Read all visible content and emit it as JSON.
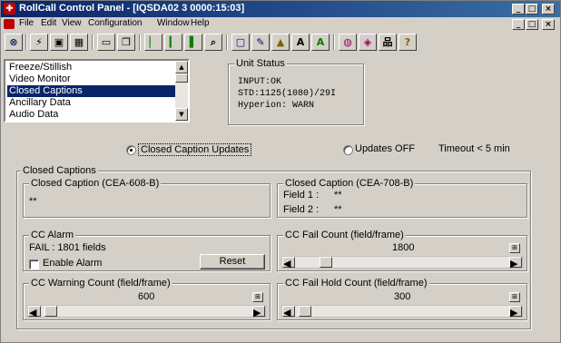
{
  "window": {
    "title": "RollCall Control Panel - [IQSDA02 3 0000:15:03]",
    "title_bg": "#0a246a"
  },
  "caption_buttons": {
    "minimize": "_",
    "maximize": "□",
    "close": "×"
  },
  "menu": {
    "items": [
      "File",
      "Edit",
      "View",
      "Configuration",
      "Window",
      "Help"
    ]
  },
  "toolbar": {
    "tools": [
      {
        "icon": "net-icon",
        "glyph": "⊗"
      },
      {
        "icon": "wand-icon",
        "glyph": "⚡"
      },
      {
        "icon": "image-icon",
        "glyph": "▣"
      },
      {
        "icon": "save-icon",
        "glyph": "▦"
      },
      {
        "icon": "monitor-icon",
        "glyph": "▭"
      },
      {
        "icon": "copy-icon",
        "glyph": "❐"
      },
      {
        "icon": "bar-low-icon",
        "glyph": "▏"
      },
      {
        "icon": "bar-mid-icon",
        "glyph": "▎"
      },
      {
        "icon": "bars-icon",
        "glyph": "▌"
      },
      {
        "icon": "zoom-icon",
        "glyph": "⌕"
      },
      {
        "icon": "screen-icon",
        "glyph": "▢"
      },
      {
        "icon": "edit-icon",
        "glyph": "✎"
      },
      {
        "icon": "lock-icon",
        "glyph": "▲"
      },
      {
        "icon": "font-a-icon",
        "glyph": "A"
      },
      {
        "icon": "font-a-green-icon",
        "glyph": "A"
      },
      {
        "icon": "globe-icon",
        "glyph": "◍"
      },
      {
        "icon": "shield-icon",
        "glyph": "◈"
      },
      {
        "icon": "network-icon",
        "glyph": "品"
      },
      {
        "icon": "help-icon",
        "glyph": "?"
      }
    ]
  },
  "list": {
    "items": [
      "Freeze/Stillish",
      "Video Monitor",
      "Closed Captions",
      "Ancillary Data",
      "Audio Data"
    ],
    "selected_index": 2
  },
  "unit_status": {
    "label": "Unit Status",
    "lines": [
      "INPUT:OK",
      "STD:1125(1080)/29I",
      "Hyperion: WARN"
    ]
  },
  "mode": {
    "updates_on_label": "Closed Caption Updates",
    "updates_off_label": "Updates OFF",
    "timeout_label": "Timeout < 5 min",
    "selected": "updates_on"
  },
  "captions": {
    "group_label": "Closed Captions",
    "cea608": {
      "label": "Closed Caption (CEA-608-B)",
      "value": "**"
    },
    "cea708": {
      "label": "Closed Caption (CEA-708-B)",
      "field1_label": "Field 1 :",
      "field1_value": "**",
      "field2_label": "Field 2 :",
      "field2_value": "**"
    }
  },
  "cc_alarm": {
    "label": "CC Alarm",
    "status": "FAIL : 1801 fields",
    "enable_label": "Enable Alarm",
    "enabled": false,
    "reset_label": "Reset"
  },
  "cc_fail_count": {
    "label": "CC Fail Count (field/frame)",
    "value": "1800",
    "position": 0.12
  },
  "cc_warning_count": {
    "label": "CC Warning Count (field/frame)",
    "value": "600",
    "position": 0.02
  },
  "cc_fail_hold_count": {
    "label": "CC Fail Hold Count (field/frame)",
    "value": "300",
    "position": 0.02
  },
  "scroll_glyphs": {
    "left": "◀",
    "right": "▶",
    "up": "▲",
    "down": "▼",
    "mini": "⊞"
  }
}
